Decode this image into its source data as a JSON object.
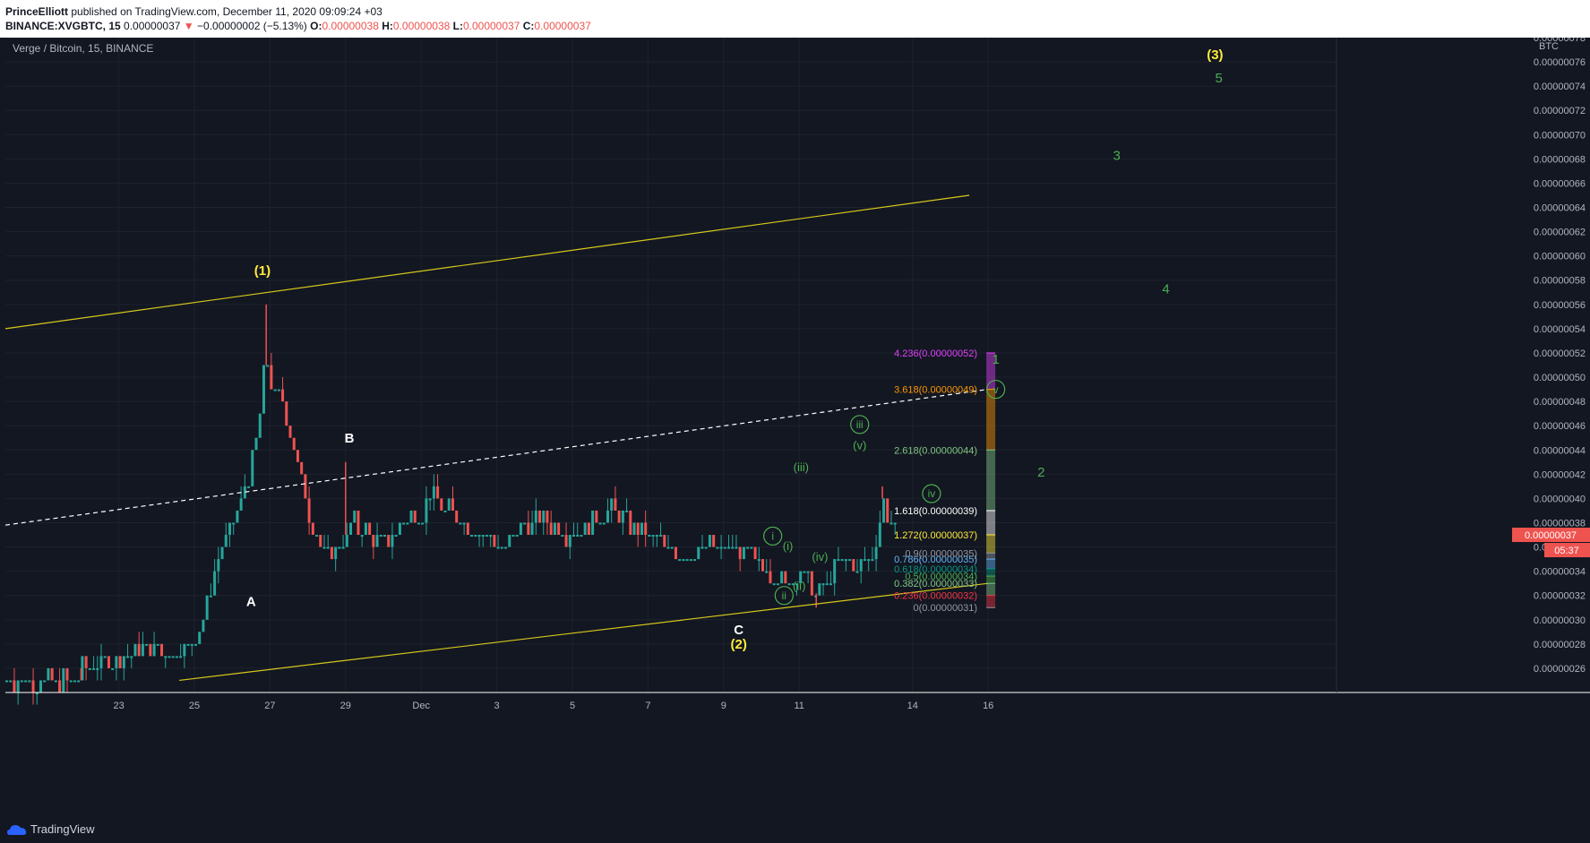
{
  "header": {
    "author": "PrinceElliott",
    "published_text": "published on TradingView.com, December 11, 2020 09:09:24 +03",
    "symbol_line": "BINANCE:XVGBTC, 15",
    "last_price": "0.00000037",
    "change_arrow": "▼",
    "change": "−0.00000002 (−5.13%)",
    "o_label": "O:",
    "o_value": "0.00000038",
    "h_label": "H:",
    "h_value": "0.00000038",
    "l_label": "L:",
    "l_value": "0.00000037",
    "c_label": "C:",
    "c_value": "0.00000037"
  },
  "chart_title": "Verge / Bitcoin, 15, BINANCE",
  "currency_label": "BTC",
  "price_badge": "0.00000037",
  "countdown_badge": "05:37",
  "footer": {
    "brand": "TradingView"
  },
  "colors": {
    "background": "#131722",
    "up_candle": "#26a69a",
    "down_candle": "#ef5350",
    "trendline": "#d6c81a",
    "wave_yellow": "#ffeb3b",
    "wave_green": "#4caf50",
    "wave_white": "#ffffff"
  },
  "chart_data": {
    "type": "candlestick",
    "title": "Verge / Bitcoin, 15, BINANCE",
    "ylabel": "BTC",
    "ylim": [
      2.4e-07,
      7.8e-07
    ],
    "y_ticks": [
      "0.00000026",
      "0.00000028",
      "0.00000030",
      "0.00000032",
      "0.00000034",
      "0.00000036",
      "0.00000038",
      "0.00000040",
      "0.00000042",
      "0.00000044",
      "0.00000046",
      "0.00000048",
      "0.00000050",
      "0.00000052",
      "0.00000054",
      "0.00000056",
      "0.00000058",
      "0.00000060",
      "0.00000062",
      "0.00000064",
      "0.00000066",
      "0.00000068",
      "0.00000070",
      "0.00000072",
      "0.00000074",
      "0.00000076",
      "0.00000078"
    ],
    "x_ticks": [
      "23",
      "25",
      "27",
      "29",
      "Dec",
      "3",
      "5",
      "7",
      "9",
      "11",
      "14",
      "16"
    ],
    "price_path": [
      [
        0.0,
        2.5e-07
      ],
      [
        2.0,
        2.5e-07
      ],
      [
        2.0,
        2.6e-07
      ],
      [
        3.0,
        2.7e-07
      ],
      [
        3.8,
        2.8e-07
      ],
      [
        4.4,
        2.7e-07
      ],
      [
        4.8,
        2.8e-07
      ],
      [
        5.0,
        2.9e-07
      ],
      [
        5.3,
        3.1e-07
      ],
      [
        5.5,
        3.4e-07
      ],
      [
        5.7,
        3.6e-07
      ],
      [
        6.0,
        3.8e-07
      ],
      [
        6.3,
        4.1e-07
      ],
      [
        6.5,
        4.3e-07
      ],
      [
        6.7,
        4.7e-07
      ],
      [
        6.85,
        5.2e-07
      ],
      [
        7.0,
        4.9e-07
      ],
      [
        7.3,
        4.8e-07
      ],
      [
        7.6,
        4.4e-07
      ],
      [
        7.9,
        4e-07
      ],
      [
        8.2,
        3.7e-07
      ],
      [
        8.5,
        3.5e-07
      ],
      [
        8.8,
        3.6e-07
      ],
      [
        9.2,
        3.8e-07
      ],
      [
        9.6,
        3.7e-07
      ],
      [
        10.0,
        3.6e-07
      ],
      [
        10.5,
        3.8e-07
      ],
      [
        11.0,
        3.9e-07
      ],
      [
        11.2,
        4.1e-07
      ],
      [
        11.6,
        3.9e-07
      ],
      [
        12.2,
        3.8e-07
      ],
      [
        12.8,
        3.7e-07
      ],
      [
        13.2,
        3.6e-07
      ],
      [
        13.6,
        3.8e-07
      ],
      [
        14.2,
        3.8e-07
      ],
      [
        15.0,
        3.7e-07
      ],
      [
        15.6,
        3.8e-07
      ],
      [
        16.0,
        3.9e-07
      ],
      [
        16.5,
        3.8e-07
      ],
      [
        17.0,
        3.7e-07
      ],
      [
        17.5,
        3.6e-07
      ],
      [
        18.0,
        3.5e-07
      ],
      [
        18.6,
        3.6e-07
      ],
      [
        19.2,
        3.6e-07
      ],
      [
        19.7,
        3.5e-07
      ],
      [
        20.2,
        3.4e-07
      ],
      [
        20.6,
        3.3e-07
      ],
      [
        21.0,
        3.4e-07
      ],
      [
        21.4,
        3.2e-07
      ],
      [
        21.7,
        3.3e-07
      ],
      [
        22.1,
        3.5e-07
      ],
      [
        22.5,
        3.4e-07
      ],
      [
        22.9,
        3.5e-07
      ],
      [
        23.2,
        4e-07
      ],
      [
        23.4,
        3.8e-07
      ],
      [
        23.55,
        3.7e-07
      ]
    ],
    "price_extremes": [
      [
        2.0,
        2.6e-07
      ],
      [
        6.9,
        5.6e-07
      ],
      [
        9.0,
        4.3e-07
      ],
      [
        21.45,
        3.1e-07
      ],
      [
        23.2,
        4.1e-07
      ]
    ],
    "trendlines": [
      {
        "style": "solid",
        "color": "#d6c81a",
        "from": [
          0.0,
          5.4e-07
        ],
        "to": [
          25.5,
          6.5e-07
        ]
      },
      {
        "style": "solid",
        "color": "#d6c81a",
        "from": [
          4.6,
          2.5e-07
        ],
        "to": [
          26.0,
          3.3e-07
        ]
      },
      {
        "style": "dashed",
        "color": "#ffffff",
        "from": [
          0.0,
          3.78e-07
        ],
        "to": [
          26.0,
          4.9e-07
        ]
      }
    ],
    "fib_levels": [
      {
        "label": "0(0.00000031)",
        "value": 3.1e-07,
        "color": "#9598a1"
      },
      {
        "label": "0.236(0.00000032)",
        "value": 3.2e-07,
        "color": "#f23645"
      },
      {
        "label": "0.382(0.00000033)",
        "value": 3.3e-07,
        "color": "#81c784"
      },
      {
        "label": "0.5(0.00000034)",
        "value": 3.36e-07,
        "color": "#4caf50"
      },
      {
        "label": "0.618(0.00000034)",
        "value": 3.42e-07,
        "color": "#089981"
      },
      {
        "label": "0.786(0.00000035)",
        "value": 3.5e-07,
        "color": "#64b5f6"
      },
      {
        "label": "0.9(0.00000035)",
        "value": 3.55e-07,
        "color": "#9598a1"
      },
      {
        "label": "1.272(0.00000037)",
        "value": 3.7e-07,
        "color": "#ffeb3b"
      },
      {
        "label": "1.618(0.00000039)",
        "value": 3.9e-07,
        "color": "#ffffff"
      },
      {
        "label": "2.618(0.00000044)",
        "value": 4.4e-07,
        "color": "#81c784"
      },
      {
        "label": "3.618(0.00000049)",
        "value": 4.9e-07,
        "color": "#ff9800"
      },
      {
        "label": "4.236(0.00000052)",
        "value": 5.2e-07,
        "color": "#e040fb"
      }
    ],
    "wave_labels": [
      {
        "text": "(1)",
        "x": 6.8,
        "y": 5.88e-07,
        "color": "#ffeb3b",
        "circle": false
      },
      {
        "text": "(2)",
        "x": 19.4,
        "y": 2.8e-07,
        "color": "#ffeb3b",
        "circle": false
      },
      {
        "text": "(3)",
        "x": 32.0,
        "y": 7.66e-07,
        "color": "#ffeb3b",
        "circle": false
      },
      {
        "text": "A",
        "x": 6.5,
        "y": 3.15e-07,
        "color": "#ffffff",
        "circle": false
      },
      {
        "text": "B",
        "x": 9.1,
        "y": 4.5e-07,
        "color": "#ffffff",
        "circle": false
      },
      {
        "text": "C",
        "x": 19.4,
        "y": 2.92e-07,
        "color": "#ffffff",
        "circle": false
      },
      {
        "text": "i",
        "x": 20.3,
        "y": 3.69e-07,
        "color": "#4caf50",
        "circle": true
      },
      {
        "text": "(i)",
        "x": 20.7,
        "y": 3.61e-07,
        "color": "#4caf50",
        "circle": false
      },
      {
        "text": "ii",
        "x": 20.6,
        "y": 3.2e-07,
        "color": "#4caf50",
        "circle": true
      },
      {
        "text": "(ii)",
        "x": 21.0,
        "y": 3.28e-07,
        "color": "#4caf50",
        "circle": false
      },
      {
        "text": "(iii)",
        "x": 21.05,
        "y": 4.26e-07,
        "color": "#4caf50",
        "circle": false
      },
      {
        "text": "iii",
        "x": 22.6,
        "y": 4.61e-07,
        "color": "#4caf50",
        "circle": true
      },
      {
        "text": "(iv)",
        "x": 21.55,
        "y": 3.52e-07,
        "color": "#4caf50",
        "circle": false
      },
      {
        "text": "iv",
        "x": 24.5,
        "y": 4.04e-07,
        "color": "#4caf50",
        "circle": true
      },
      {
        "text": "(v)",
        "x": 22.6,
        "y": 4.44e-07,
        "color": "#4caf50",
        "circle": false
      },
      {
        "text": "v",
        "x": 26.2,
        "y": 4.9e-07,
        "color": "#4caf50",
        "circle": true
      },
      {
        "text": "1",
        "x": 26.2,
        "y": 5.15e-07,
        "color": "#4caf50",
        "circle": false
      },
      {
        "text": "2",
        "x": 27.4,
        "y": 4.22e-07,
        "color": "#4caf50",
        "circle": false
      },
      {
        "text": "3",
        "x": 29.4,
        "y": 6.83e-07,
        "color": "#4caf50",
        "circle": false
      },
      {
        "text": "4",
        "x": 30.7,
        "y": 5.73e-07,
        "color": "#4caf50",
        "circle": false
      },
      {
        "text": "5",
        "x": 32.1,
        "y": 7.47e-07,
        "color": "#4caf50",
        "circle": false
      }
    ]
  }
}
